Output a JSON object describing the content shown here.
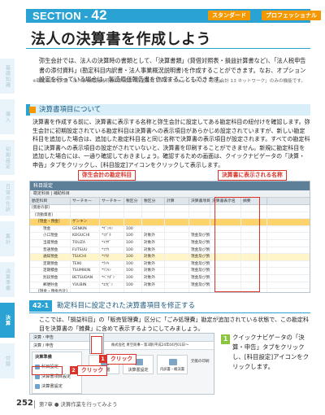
{
  "section": {
    "label": "SECTION",
    "number": "42",
    "badges": [
      "スタンダード",
      "プロフェッショナル"
    ],
    "title": "法人の決算書を作成しよう"
  },
  "side_tabs": [
    {
      "label": "基礎知識",
      "active": false
    },
    {
      "label": "導入",
      "active": false
    },
    {
      "label": "初期設定",
      "active": false
    },
    {
      "label": "日常の仕訳",
      "active": false
    },
    {
      "label": "集計",
      "active": false
    },
    {
      "label": "決算準備",
      "active": false
    },
    {
      "label": "決算",
      "active": true
    },
    {
      "label": "付録",
      "active": false
    }
  ],
  "intro": "弥生会計では、法人の決算時の書類として、「決算書類」(貸借対照表・損益計算書など)、「法人税申告書の添付資料」(勘定科目内訳書・法人事業概況説明書)を作成することができます。なお、オプション設定を行っている場合は、製造原価報告書を作成することもできます。",
  "note": "※勘定科目内訳書・法人事業概況説明書の作成は「弥生会計 13 プロフェッショナル」「弥生会計 13 ネットワーク」のみの機能です。",
  "sub_heading": "決算書項目について",
  "para2": "決算書を作成する前に、決算書に表示する名称と弥生会計に設定してある勘定科目の紐付けを確認します。弥生会計に初期設定されている勘定科目は決算書への表示項目があらかじめ設定されていますが、新しい勘定科目を追加した場合は、追加した勘定科目名と同じ名称で決算書の表示項目が設定されます。すべての勘定科目に決算書への表示項目の設定がされていないと、決算書を印刷することができません。新規に勘定科目を追加した場合には、一通り確認しておきましょう。確認するための画面は、クイックナビゲータの「決算・申告」タブをクリックし、[科目設定]アイコンをクリックして表示します。",
  "callouts": {
    "left": "弥生会計の勘定科目",
    "right": "決算書に表示される名称"
  },
  "shot1": {
    "window_title": "科目設定",
    "toolbar": "勘定科目 | 補助科目",
    "columns": [
      "勘定科目",
      "サーチキー",
      "サーチキー",
      "税区分",
      "税区分",
      "計算",
      "決算書項目",
      "決算書表示名",
      "摘要"
    ],
    "rows": [
      {
        "cells": [
          "[資産の部]",
          "",
          "",
          "",
          "",
          "",
          "",
          "",
          ""
        ],
        "style": ""
      },
      {
        "cells": [
          "[流動資産]",
          "",
          "",
          "",
          "",
          "",
          "",
          "",
          ""
        ],
        "style": ""
      },
      {
        "cells": [
          "[現金・預金]",
          "ゲンキン",
          "",
          "",
          "",
          "",
          "",
          "",
          ""
        ],
        "style": "sel"
      },
      {
        "cells": [
          "現金",
          "GENKIN",
          "*ｹﾞﾝｷﾝ",
          "100",
          "",
          "",
          "",
          "",
          ""
        ],
        "style": ""
      },
      {
        "cells": [
          "小口現金",
          "KOGUCHI",
          "*ｺｸﾞﾁ",
          "100",
          "対象外",
          "",
          "現金及び預金",
          "",
          ""
        ],
        "style": ""
      },
      {
        "cells": [
          "当座預金",
          "TOUZA",
          "*ﾄｳｻﾞ",
          "100",
          "対象外",
          "",
          "現金及び預金",
          "",
          ""
        ],
        "style": ""
      },
      {
        "cells": [
          "普通預金",
          "FUTSUU",
          "*ﾌﾂｳ",
          "100",
          "対象外",
          "",
          "現金及び預金",
          "",
          ""
        ],
        "style": ""
      },
      {
        "cells": [
          "通知預金",
          "TSUCHI",
          "*ﾂｳﾁ",
          "100",
          "対象外",
          "",
          "現金及び預金",
          "",
          ""
        ],
        "style": "hl"
      },
      {
        "cells": [
          "定期預金",
          "TEIKI",
          "*ﾃｲｷ",
          "100",
          "対象外",
          "",
          "現金及び預金",
          "",
          ""
        ],
        "style": ""
      },
      {
        "cells": [
          "定期積金",
          "TSUMIKIN",
          "*ﾂﾐｷﾝ",
          "100",
          "対象外",
          "",
          "現金及び預金",
          "",
          ""
        ],
        "style": ""
      },
      {
        "cells": [
          "別段預金",
          "BETSUDAN",
          "*ﾍﾞﾂﾀﾞﾝ",
          "100",
          "対象外",
          "",
          "現金及び預金",
          "",
          ""
        ],
        "style": ""
      },
      {
        "cells": [
          "郵便貯金",
          "YUUBIN",
          "*ﾕｳﾋﾞﾝ",
          "100",
          "対象外",
          "",
          "現金及び預金",
          "",
          ""
        ],
        "style": ""
      },
      {
        "cells": [
          "[現金・預金合計]",
          "",
          "",
          "",
          "",
          "",
          "",
          "",
          ""
        ],
        "style": ""
      },
      {
        "cells": [
          "[売上債権]",
          "URIAGE",
          "*ｳﾘｱｹﾞ",
          "",
          "",
          "",
          "",
          "",
          ""
        ],
        "style": ""
      },
      {
        "cells": [
          "受取手形",
          "UKETORI",
          "*ｳｹﾄﾘ",
          "100",
          "対象外",
          "",
          "受取手形",
          "",
          ""
        ],
        "style": ""
      }
    ]
  },
  "s42": {
    "number": "42-1",
    "title": "勘定科目に設定された決算書項目を修正する",
    "text": "ここでは、「損益科目」の「販売管理費」区分に「ごみ処理費」勘定が追加されている状態で、この勘定科目を決算書の「雑費」に含めて表示するようにしてみましょう。"
  },
  "shot2": {
    "tab_left": "決算・申告",
    "header_left": "決算 / 申告",
    "header_right": "株式会社 青空商事・第3期(平成24年04月01日〜",
    "group_title": "決算準備",
    "nav_items": [
      "科目設定",
      "決算書項目設定",
      "決算書設定"
    ],
    "buttons": [
      {
        "label": "決算書",
        "id": "a"
      },
      {
        "label": "決算書設定",
        "id": "b"
      },
      {
        "label": "内訳書・概況書",
        "id": "c"
      }
    ],
    "side_label": "元帳の印刷",
    "marker1_label": "クリック",
    "marker2_label": "クリック"
  },
  "step": {
    "number": "1",
    "text": "クイックナビゲータの「決算・申告」タブをクリックし、[科目設定]アイコンをクリックします。"
  },
  "footer": {
    "page": "252",
    "chapter": "第7章 ● 決算作業を行ってみよう"
  },
  "colors": {
    "accent": "#2aa3d4",
    "badge": "#f39800",
    "callout": "#d9342b",
    "step": "#8cc63f"
  }
}
